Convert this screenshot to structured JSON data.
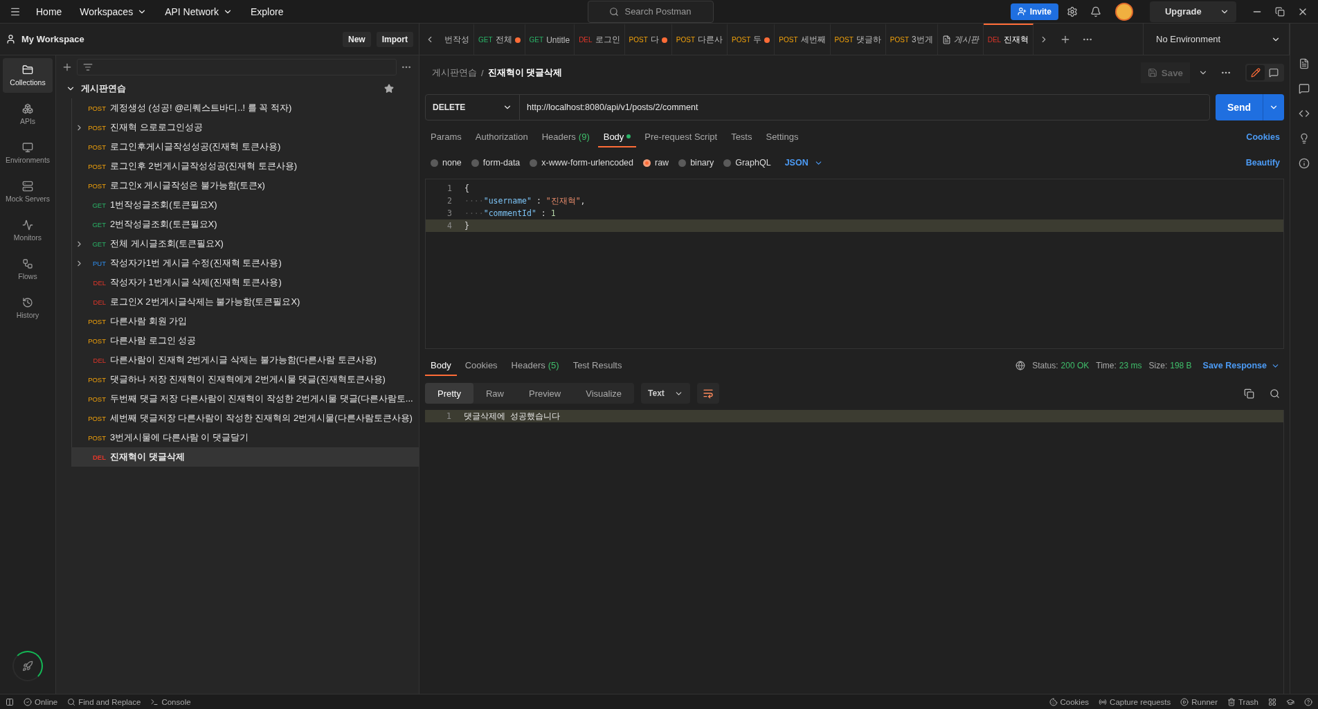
{
  "top_bar": {
    "nav": [
      {
        "label": "Home",
        "dropdown": false
      },
      {
        "label": "Workspaces",
        "dropdown": true
      },
      {
        "label": "API Network",
        "dropdown": true
      },
      {
        "label": "Explore",
        "dropdown": false
      }
    ],
    "search": {
      "placeholder": "Search Postman"
    },
    "invite": "Invite",
    "upgrade": "Upgrade"
  },
  "workspace": {
    "title": "My Workspace",
    "buttons": [
      "New",
      "Import"
    ]
  },
  "rail": [
    {
      "label": "Collections",
      "selected": true
    },
    {
      "label": "APIs",
      "selected": false
    },
    {
      "label": "Environments",
      "selected": false
    },
    {
      "label": "Mock Servers",
      "selected": false
    },
    {
      "label": "Monitors",
      "selected": false
    },
    {
      "label": "Flows",
      "selected": false
    },
    {
      "label": "History",
      "selected": false
    }
  ],
  "collection": {
    "name": "게시판연습",
    "expanded": true,
    "starred": true,
    "requests": [
      {
        "method": "POST",
        "name": "계정생성 (성공! @리퀘스트바디..! 를 꼭 적자)",
        "expandable": false,
        "selected": false
      },
      {
        "method": "POST",
        "name": "진재혁 으로로그인성공",
        "expandable": true,
        "selected": false
      },
      {
        "method": "POST",
        "name": "로그인후게시글작성성공(진재혁 토큰사용)",
        "expandable": false,
        "selected": false
      },
      {
        "method": "POST",
        "name": "로그인후 2번게시글작성성공(진재혁 토큰사용)",
        "expandable": false,
        "selected": false
      },
      {
        "method": "POST",
        "name": "로그인x 게시글작성은 불가능함(토큰x)",
        "expandable": false,
        "selected": false
      },
      {
        "method": "GET",
        "name": "1번작성글조회(토큰필요X)",
        "expandable": false,
        "selected": false
      },
      {
        "method": "GET",
        "name": "2번작성글조회(토큰필요X)",
        "expandable": false,
        "selected": false
      },
      {
        "method": "GET",
        "name": "전체 게시글조회(토큰필요X)",
        "expandable": true,
        "selected": false
      },
      {
        "method": "PUT",
        "name": "작성자가1번 게시글 수정(진재혁 토큰사용)",
        "expandable": true,
        "selected": false
      },
      {
        "method": "DEL",
        "name": "작성자가 1번게시글 삭제(진재혁 토큰사용)",
        "expandable": false,
        "selected": false
      },
      {
        "method": "DEL",
        "name": "로그인X 2번게시글삭제는 불가능함(토큰필요X)",
        "expandable": false,
        "selected": false
      },
      {
        "method": "POST",
        "name": "다른사람 회원 가입",
        "expandable": false,
        "selected": false
      },
      {
        "method": "POST",
        "name": "다른사람 로그인 성공",
        "expandable": false,
        "selected": false
      },
      {
        "method": "DEL",
        "name": "다른사람이 진재혁 2번게시글 삭제는 불가능함(다른사람 토큰사용)",
        "expandable": false,
        "selected": false
      },
      {
        "method": "POST",
        "name": "댓글하나 저장 진재혁이 진재혁에게 2번게시물 댓글(진재혁토큰사용)",
        "expandable": false,
        "selected": false
      },
      {
        "method": "POST",
        "name": "두번째 댓글 저장 다른사람이 진재혁이 작성한 2번게시물 댓글(다른사람토...",
        "expandable": false,
        "selected": false
      },
      {
        "method": "POST",
        "name": "세번째 댓글저장 다른사람이 작성한 진재혁의 2번게시물(다른사람토큰사용)",
        "expandable": false,
        "selected": false
      },
      {
        "method": "POST",
        "name": "3번게시물에 다른사람 이 댓글달기",
        "expandable": false,
        "selected": false
      },
      {
        "method": "DEL",
        "name": "진재혁이 댓글삭제",
        "expandable": false,
        "selected": true
      }
    ]
  },
  "tabs": [
    {
      "kind": "request",
      "title": "번작성",
      "unsaved": false,
      "selected": false
    },
    {
      "kind": "request",
      "method": "GET",
      "title": "전체",
      "unsaved": true,
      "selected": false
    },
    {
      "kind": "request",
      "method": "GET",
      "title": "Untitle",
      "unsaved": false,
      "selected": false
    },
    {
      "kind": "request",
      "method": "DEL",
      "title": "로그인",
      "unsaved": false,
      "selected": false
    },
    {
      "kind": "request",
      "method": "POST",
      "title": "다",
      "unsaved": true,
      "selected": false
    },
    {
      "kind": "request",
      "method": "POST",
      "title": "다른사",
      "unsaved": false,
      "selected": false
    },
    {
      "kind": "request",
      "method": "POST",
      "title": "두",
      "unsaved": true,
      "selected": false
    },
    {
      "kind": "request",
      "method": "POST",
      "title": "세번째",
      "unsaved": false,
      "selected": false
    },
    {
      "kind": "request",
      "method": "POST",
      "title": "댓글하",
      "unsaved": false,
      "selected": false
    },
    {
      "kind": "request",
      "method": "POST",
      "title": "3번게",
      "unsaved": false,
      "selected": false
    },
    {
      "kind": "collection",
      "title": "게시판",
      "unsaved": false,
      "selected": false
    },
    {
      "kind": "request",
      "method": "DEL",
      "title": "진재혁",
      "unsaved": false,
      "selected": true
    }
  ],
  "environment": "No Environment",
  "breadcrumb": {
    "parent": "게시판연습",
    "separator": "/",
    "current": "진재혁이 댓글삭제"
  },
  "save": "Save",
  "request": {
    "method": "DELETE",
    "url": "http://localhost:8080/api/v1/posts/2/comment",
    "send": "Send"
  },
  "request_tabs": [
    {
      "label": "Params",
      "selected": false
    },
    {
      "label": "Authorization",
      "selected": false
    },
    {
      "label": "Headers",
      "count": "(9)",
      "selected": false
    },
    {
      "label": "Body",
      "has_content": true,
      "selected": true
    },
    {
      "label": "Pre-request Script",
      "selected": false
    },
    {
      "label": "Tests",
      "selected": false
    },
    {
      "label": "Settings",
      "selected": false
    }
  ],
  "cookies_link": "Cookies",
  "body_modes": [
    {
      "label": "none",
      "selected": false
    },
    {
      "label": "form-data",
      "selected": false
    },
    {
      "label": "x-www-form-urlencoded",
      "selected": false
    },
    {
      "label": "raw",
      "selected": true
    },
    {
      "label": "binary",
      "selected": false
    },
    {
      "label": "GraphQL",
      "selected": false
    }
  ],
  "body_format": "JSON",
  "beautify": "Beautify",
  "body_lines": [
    {
      "number": "1",
      "active": false,
      "tokens": [
        {
          "kind": "punct",
          "text": "{"
        }
      ]
    },
    {
      "number": "2",
      "active": false,
      "tokens": [
        {
          "kind": "space",
          "text": "····"
        },
        {
          "kind": "key",
          "text": "\"username\""
        },
        {
          "kind": "punct",
          "text": " : "
        },
        {
          "kind": "string",
          "text": "\"진재혁\""
        },
        {
          "kind": "punct",
          "text": ","
        }
      ]
    },
    {
      "number": "3",
      "active": false,
      "tokens": [
        {
          "kind": "space",
          "text": "····"
        },
        {
          "kind": "key",
          "text": "\"commentId\""
        },
        {
          "kind": "punct",
          "text": " : "
        },
        {
          "kind": "number",
          "text": "1"
        }
      ]
    },
    {
      "number": "4",
      "active": true,
      "tokens": [
        {
          "kind": "punct",
          "text": "}"
        }
      ]
    }
  ],
  "response_tabs": [
    {
      "label": "Body",
      "selected": true
    },
    {
      "label": "Cookies",
      "selected": false
    },
    {
      "label": "Headers",
      "count": "(5)",
      "selected": false
    },
    {
      "label": "Test Results",
      "selected": false
    }
  ],
  "response_meta": [
    {
      "label": "Status:",
      "value": "200 OK"
    },
    {
      "label": "Time:",
      "value": "23 ms"
    },
    {
      "label": "Size:",
      "value": "198 B"
    }
  ],
  "save_response": "Save Response",
  "view_tabs": [
    {
      "label": "Pretty",
      "selected": true
    },
    {
      "label": "Raw",
      "selected": false
    },
    {
      "label": "Preview",
      "selected": false
    },
    {
      "label": "Visualize",
      "selected": false
    }
  ],
  "response_format": "Text",
  "response_lines": [
    {
      "number": "1",
      "text": "댓글삭제에 성공했습니다"
    }
  ],
  "status_bar": {
    "left": [
      "Online",
      "Find and Replace",
      "Console"
    ],
    "right": [
      "Cookies",
      "Capture requests",
      "Runner",
      "Trash"
    ]
  }
}
